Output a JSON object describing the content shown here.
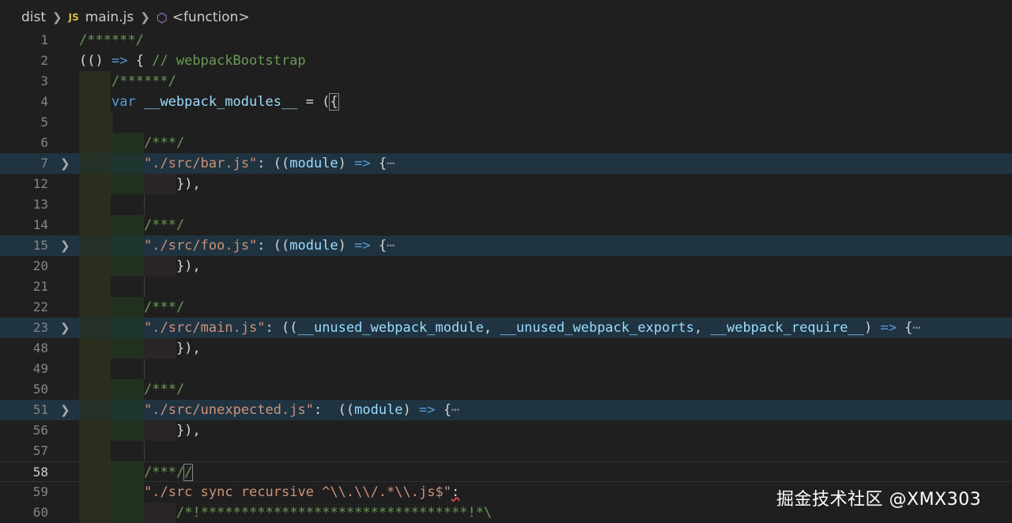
{
  "breadcrumb": {
    "folder": "dist",
    "file_badge": "JS",
    "file": "main.js",
    "symbol": "<function>"
  },
  "editor": {
    "lines": [
      {
        "num": "1"
      },
      {
        "num": "2"
      },
      {
        "num": "3"
      },
      {
        "num": "4"
      },
      {
        "num": "5"
      },
      {
        "num": "6"
      },
      {
        "num": "7"
      },
      {
        "num": "12"
      },
      {
        "num": "13"
      },
      {
        "num": "14"
      },
      {
        "num": "15"
      },
      {
        "num": "20"
      },
      {
        "num": "21"
      },
      {
        "num": "22"
      },
      {
        "num": "23"
      },
      {
        "num": "48"
      },
      {
        "num": "49"
      },
      {
        "num": "50"
      },
      {
        "num": "51"
      },
      {
        "num": "56"
      },
      {
        "num": "57"
      },
      {
        "num": "58"
      },
      {
        "num": "59"
      },
      {
        "num": "60"
      }
    ],
    "tokens": {
      "l1_comment": "/******/",
      "l2_open": "(()",
      "l2_arrow": "=>",
      "l2_brace": "{",
      "l2_comment": "// webpackBootstrap",
      "l3_comment": "/******/",
      "l4_var": "var",
      "l4_name": "__webpack_modules__",
      "l4_eq": " = (",
      "l4_brace": "{",
      "marker_comment": "/***/",
      "bar_path": "\"./src/bar.js\"",
      "foo_path": "\"./src/foo.js\"",
      "main_path": "\"./src/main.js\"",
      "unexpected_path": "\"./src/unexpected.js\"",
      "colon_open": ": ((",
      "colon_open_wide": ":  ((",
      "param_module": "module",
      "param_unused_module": "__unused_webpack_module",
      "param_unused_exports": "__unused_webpack_exports",
      "param_require": "__webpack_require__",
      "comma": ", ",
      "close_paren": ") ",
      "arrow": "=>",
      "open_brace": " {",
      "collapsed": "⋯",
      "close_block": "}),",
      "l58_close": "/",
      "l59_key": "\"./src sync recursive ^\\\\.\\\\/.*\\\\.js$\"",
      "l59_colon": ":",
      "l60_comment": "/*!*********************************!*\\"
    }
  },
  "watermark": "掘金技术社区 @XMX303"
}
